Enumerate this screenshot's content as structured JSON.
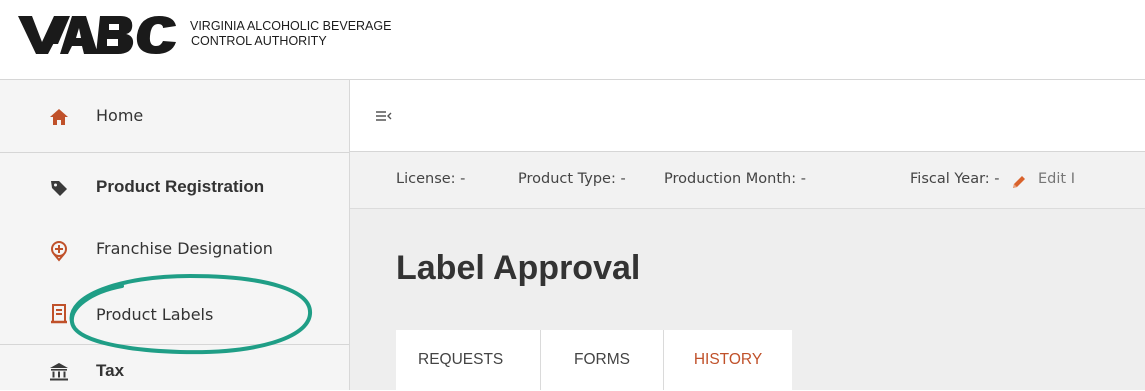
{
  "header": {
    "logo_line1": "VIRGINIA ALCOHOLIC BEVERAGE",
    "logo_line2": "CONTROL AUTHORITY",
    "logo_mark_text": "VA ABC"
  },
  "sidebar": {
    "items": [
      {
        "label": "Home",
        "icon": "home-icon"
      },
      {
        "label": "Product Registration",
        "icon": "tag-icon"
      },
      {
        "label": "Franchise Designation",
        "icon": "location-pin-icon"
      },
      {
        "label": "Product Labels",
        "icon": "document-label-icon"
      },
      {
        "label": "Tax",
        "icon": "bank-icon"
      }
    ]
  },
  "filters": {
    "license": "License: -",
    "product_type": "Product Type: -",
    "production_month": "Production Month: -",
    "fiscal_year": "Fiscal Year: -",
    "edit": "Edit I"
  },
  "main": {
    "title": "Label Approval",
    "tabs": [
      {
        "label": "REQUESTS"
      },
      {
        "label": "FORMS"
      },
      {
        "label": "HISTORY",
        "active": true
      }
    ]
  },
  "colors": {
    "accent": "#c0512a",
    "annotation": "#1f9e86",
    "sidebar_bg": "#f5f5f5",
    "content_bg": "#eeeeee"
  }
}
